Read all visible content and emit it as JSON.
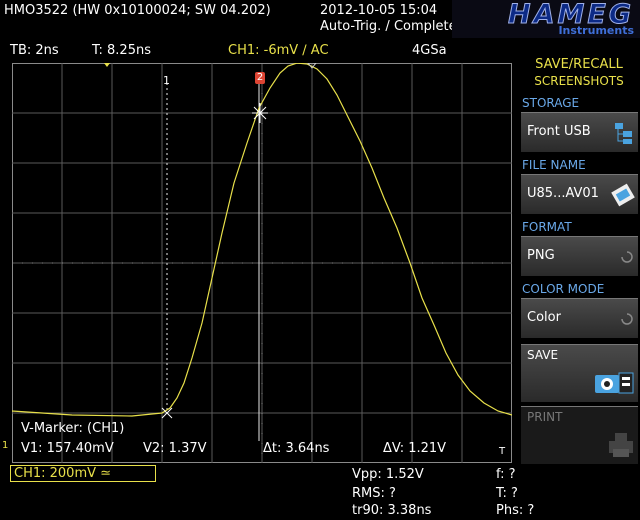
{
  "header": {
    "model_line": "HMO3522 (HW 0x10100024; SW 04.202)",
    "datetime": "2012-10-05 15:04",
    "trigger_status": "Auto-Trig. / Complete",
    "logo": "HAMEG",
    "logo_sub": "Instruments"
  },
  "infobar": {
    "timebase": "TB: 2ns",
    "trigger_time": "T: 8.25ns",
    "channel": "CH1: -6mV ∕ AC",
    "sample_rate": "4GSa"
  },
  "markers": {
    "marker1_label": "1",
    "marker2_label": "2",
    "title": "V-Marker: (CH1)",
    "v1": "V1: 157.40mV",
    "v2": "V2: 1.37V",
    "dt": "Δt: 3.64ns",
    "dv": "ΔV: 1.21V",
    "ch_ground": "1",
    "trig_marker": "T"
  },
  "channel_box": "CH1: 200mV ≃",
  "measurements": {
    "vpp": "Vpp: 1.52V",
    "rms": "RMS: ?",
    "tr90": "tr90: 3.38ns",
    "f": "f: ?",
    "t": "T: ?",
    "phs": "Phs: ?"
  },
  "sidebar": {
    "title1": "SAVE/RECALL",
    "title2": "SCREENSHOTS",
    "storage_head": "STORAGE",
    "storage_value": "Front USB",
    "filename_head": "FILE NAME",
    "filename_value": "U85...AV01",
    "format_head": "FORMAT",
    "format_value": "PNG",
    "colormode_head": "COLOR MODE",
    "colormode_value": "Color",
    "save_label": "SAVE",
    "print_label": "PRINT"
  },
  "colors": {
    "trace": "#e8e04a",
    "accent_blue": "#6aa8e8",
    "grid": "#5a5a5a"
  }
}
